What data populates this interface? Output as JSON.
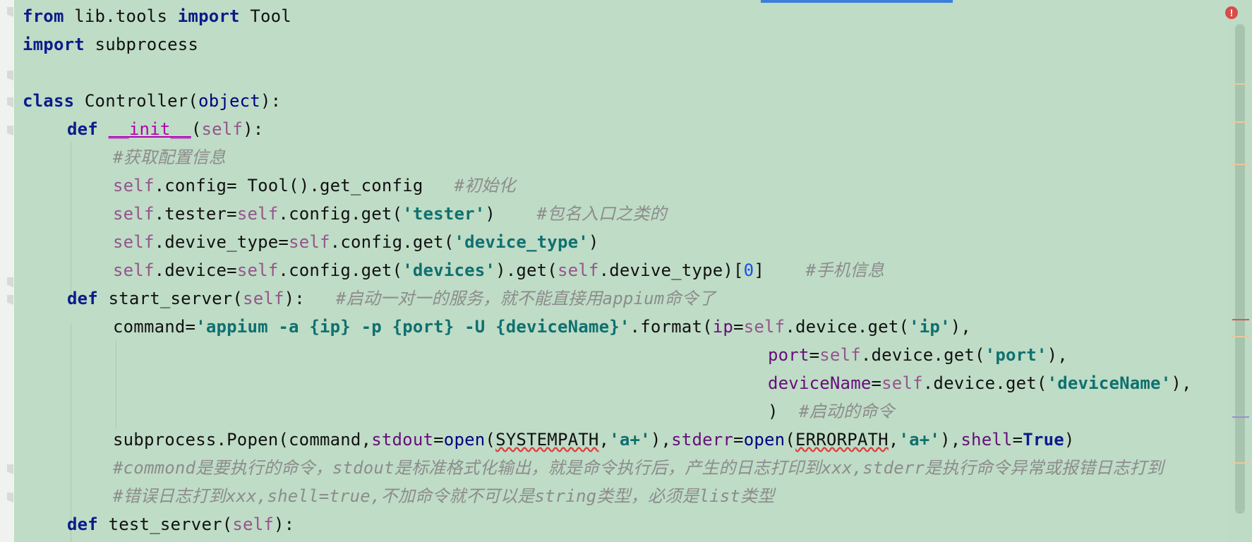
{
  "editor": {
    "lines": [
      "from lib.tools import Tool",
      "import subprocess",
      "",
      "class Controller(object):",
      "def __init__(self):",
      "#获取配置信息",
      "self.config= Tool().get_config   #初始化",
      "self.tester=self.config.get('tester')    #包名入口之类的",
      "self.devive_type=self.config.get('device_type')",
      "self.device=self.config.get('devices').get(self.devive_type)[0]    #手机信息",
      "def start_server(self):   #启动一对一的服务，就不能直接用appium命令了",
      "command='appium -a {ip} -p {port} -U {deviceName}'.format(ip=self.device.get('ip'),",
      "port=self.device.get('port'),",
      "deviceName=self.device.get('deviceName'),",
      ")  #启动的命令",
      "subprocess.Popen(command,stdout=open(SYSTEMPATH,'a+'),stderr=open(ERRORPATH,'a+'),shell=True)",
      "#commond是要执行的命令，stdout是标准格式化输出，就是命令执行后，产生的日志打印到xxx,stderr是执行命令异常或报错日志打到",
      "#错误日志打到xxx,shell=true,不加命令就不可以是string类型，必须是list类型",
      "def test_server(self):"
    ]
  },
  "tokens": {
    "l0": [
      "from",
      " lib.tools ",
      "import",
      " Tool"
    ],
    "l1": [
      "import",
      " subprocess"
    ],
    "l3": [
      "class",
      " Controller(",
      "object",
      "):"
    ],
    "l4": [
      "def",
      " ",
      "__init__",
      "(",
      "self",
      "):"
    ],
    "l5": [
      "#获取配置信息"
    ],
    "l6": [
      "self",
      ".config= Tool().get_config   ",
      "#初始化"
    ],
    "l7": [
      "self",
      ".tester=",
      "self",
      ".config.get(",
      "'tester'",
      ")    ",
      "#包名入口之类的"
    ],
    "l8": [
      "self",
      ".devive_type=",
      "self",
      ".config.get(",
      "'device_type'",
      ")"
    ],
    "l9": [
      "self",
      ".device=",
      "self",
      ".config.get(",
      "'devices'",
      ").get(",
      "self",
      ".devive_type)[",
      "0",
      "]    ",
      "#手机信息"
    ],
    "l10": [
      "def",
      " start_server(",
      "self",
      "):   ",
      "#启动一对一的服务，就不能直接用appium命令了"
    ],
    "l11": [
      "command=",
      "'appium -a ",
      "{ip}",
      " -p ",
      "{port}",
      " -U ",
      "{deviceName}",
      "'",
      ".format(",
      "ip",
      "=",
      "self",
      ".device.get(",
      "'ip'",
      "),"
    ],
    "l12": [
      "port",
      "=",
      "self",
      ".device.get(",
      "'port'",
      "),"
    ],
    "l13": [
      "deviceName",
      "=",
      "self",
      ".device.get(",
      "'deviceName'",
      "),"
    ],
    "l14": [
      ")  ",
      "#启动的命令"
    ],
    "l15": [
      "subprocess.Popen(command,",
      "stdout",
      "=",
      "open",
      "(",
      "SYSTEMPATH",
      ",",
      "'a+'",
      "),",
      "stderr",
      "=",
      "open",
      "(",
      "ERRORPATH",
      ",",
      "'a+'",
      "),",
      "shell",
      "=",
      "True",
      ")"
    ],
    "l16": [
      "#commond是要执行的命令，stdout是标准格式化输出，就是命令执行后，产生的日志打印到xxx,stderr是执行命令异常或报错日志打到"
    ],
    "l17": [
      "#错误日志打到xxx,shell=true,不加命令就不可以是string类型，必须是list类型"
    ],
    "l18": [
      "def",
      " test_server(",
      "self",
      "):"
    ]
  },
  "status": {
    "error_indicator": "!"
  },
  "colors": {
    "background": "#bfdcc6",
    "keyword": "#0b1b8a",
    "self": "#94558d",
    "string": "#067d17",
    "comment": "#8c8c8c",
    "error": "#d94a4a",
    "tab_indicator": "#3d7fd6"
  },
  "icons": {
    "error": "error-badge-icon"
  }
}
